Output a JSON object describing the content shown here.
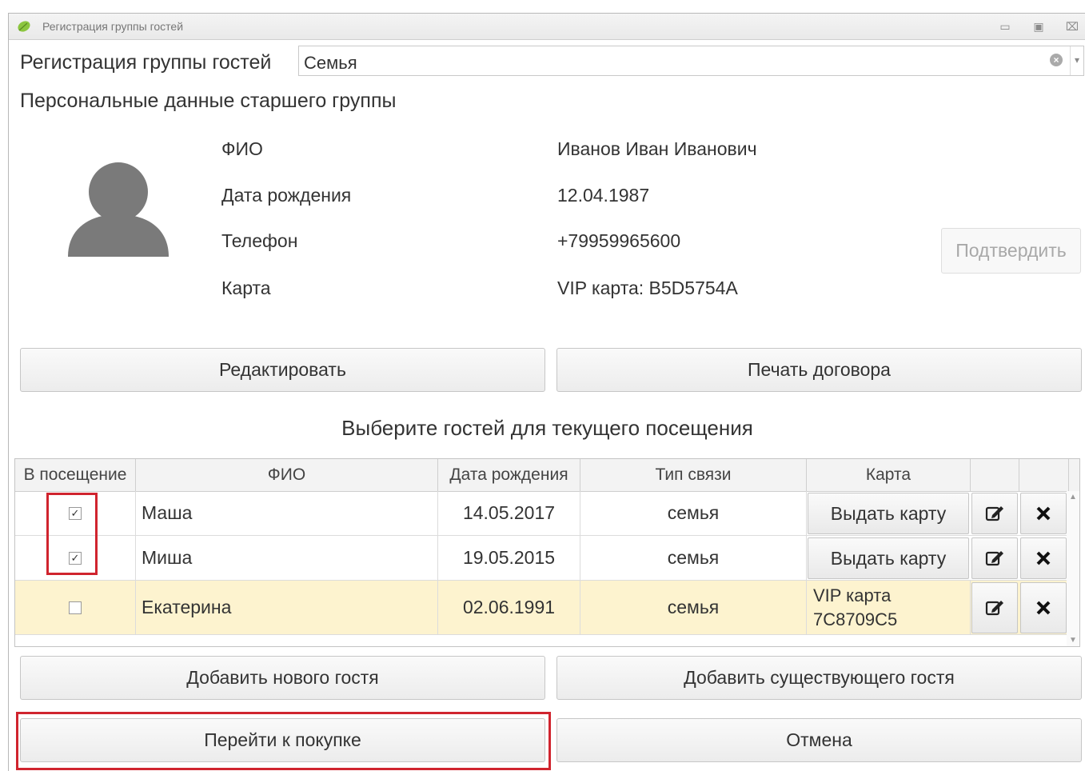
{
  "window": {
    "title": "Регистрация группы гостей"
  },
  "header": {
    "label": "Регистрация группы гостей",
    "group_value": "Семья"
  },
  "personal": {
    "section_title": "Персональные данные старшего группы",
    "fields": [
      {
        "label": "ФИО",
        "value": "Иванов Иван Иванович"
      },
      {
        "label": "Дата рождения",
        "value": "12.04.1987"
      },
      {
        "label": "Телефон",
        "value": "+79959965600"
      },
      {
        "label": "Карта",
        "value": "VIP карта: B5D5754A"
      }
    ],
    "confirm_label": "Подтвердить"
  },
  "actions": {
    "edit_label": "Редактировать",
    "print_label": "Печать договора"
  },
  "guests": {
    "title": "Выберите гостей для текущего посещения",
    "columns": [
      "В посещение",
      "ФИО",
      "Дата рождения",
      "Тип связи",
      "Карта"
    ],
    "rows": [
      {
        "checked": true,
        "name": "Маша",
        "birth": "14.05.2017",
        "relation": "семья",
        "card_button": "Выдать карту"
      },
      {
        "checked": true,
        "name": "Миша",
        "birth": "19.05.2015",
        "relation": "семья",
        "card_button": "Выдать карту"
      },
      {
        "checked": false,
        "name": "Екатерина",
        "birth": "02.06.1991",
        "relation": "семья",
        "card_line1": "VIP карта",
        "card_line2": "7C8709C5"
      }
    ]
  },
  "footer": {
    "add_new_label": "Добавить нового гостя",
    "add_existing_label": "Добавить существующего гостя",
    "purchase_label": "Перейти к покупке",
    "cancel_label": "Отмена"
  },
  "colors": {
    "highlight_row": "#fdf3cf",
    "annotation_red": "#d0242e"
  }
}
